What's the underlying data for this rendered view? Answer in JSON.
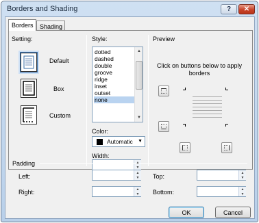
{
  "window": {
    "title": "Borders and Shading"
  },
  "titlebar": {
    "help_label": "?",
    "close_label": "✕"
  },
  "tabs": [
    {
      "label": "Borders",
      "active": true
    },
    {
      "label": "Shading",
      "active": false
    }
  ],
  "setting": {
    "label": "Setting:",
    "options": [
      {
        "label": "Default",
        "selected": true
      },
      {
        "label": "Box",
        "selected": false
      },
      {
        "label": "Custom",
        "selected": false
      }
    ]
  },
  "style": {
    "label": "Style:",
    "items": [
      "dotted",
      "dashed",
      "double",
      "groove",
      "ridge",
      "inset",
      "outset",
      "none"
    ],
    "selected": "none"
  },
  "color": {
    "label": "Color:",
    "value": "Automatic",
    "swatch": "#000000"
  },
  "width": {
    "label": "Width:",
    "value": ""
  },
  "preview": {
    "label": "Preview",
    "instructions": "Click on buttons below to apply borders"
  },
  "padding": {
    "label": "Padding",
    "left_label": "Left:",
    "right_label": "Right:",
    "top_label": "Top:",
    "bottom_label": "Bottom:",
    "left_value": "",
    "right_value": "",
    "top_value": "",
    "bottom_value": ""
  },
  "buttons": {
    "ok": "OK",
    "cancel": "Cancel"
  },
  "colors": {
    "title_bg": "#cfe0f2",
    "close_red": "#c9432a",
    "selection": "#b9d3f0"
  }
}
